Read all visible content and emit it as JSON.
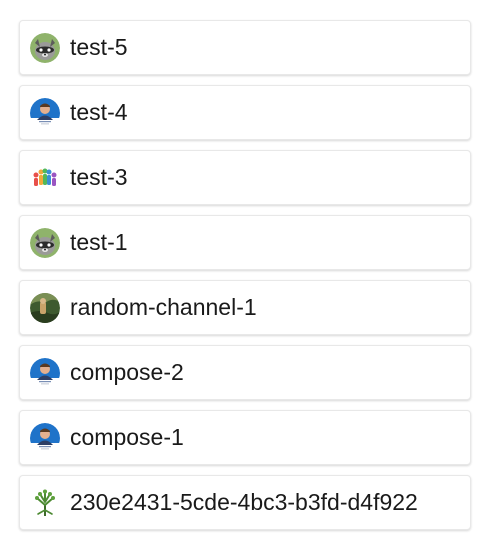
{
  "channels": [
    {
      "name": "test-5",
      "avatar": "raccoon-avatar-icon"
    },
    {
      "name": "test-4",
      "avatar": "person-avatar-icon"
    },
    {
      "name": "test-3",
      "avatar": "group-people-avatar-icon"
    },
    {
      "name": "test-1",
      "avatar": "raccoon-avatar-icon"
    },
    {
      "name": "random-channel-1",
      "avatar": "landscape-avatar-icon"
    },
    {
      "name": "compose-2",
      "avatar": "person-avatar-icon"
    },
    {
      "name": "compose-1",
      "avatar": "person-avatar-icon"
    },
    {
      "name": "230e2431-5cde-4bc3-b3fd-d4f922",
      "avatar": "tree-avatar-icon"
    }
  ]
}
